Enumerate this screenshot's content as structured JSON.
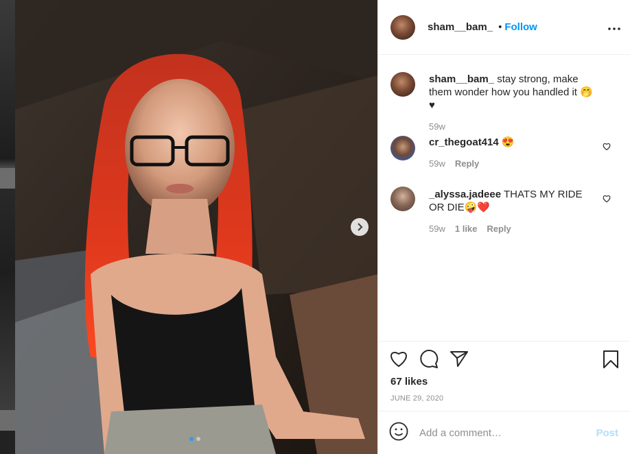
{
  "post": {
    "username": "sham__bam_",
    "separator": "•",
    "follow_label": "Follow"
  },
  "comments": [
    {
      "username": "sham__bam_",
      "text": " stay strong, make them wonder how you handled it 🤭♥",
      "time": "59w"
    },
    {
      "username": "cr_thegoat414",
      "text": " 😍",
      "time": "59w",
      "reply_label": "Reply"
    },
    {
      "username": "_alyssa.jadeee",
      "text": " THATS MY RIDE OR DIE🤪❤️",
      "time": "59w",
      "likes_label": "1 like",
      "reply_label": "Reply"
    }
  ],
  "likes_count": "67 likes",
  "post_date": "JUNE 29, 2020",
  "add_comment": {
    "placeholder": "Add a comment…",
    "post_label": "Post"
  },
  "carousel": {
    "total_slides": 2,
    "active_slide": 1
  },
  "icons": {
    "more": "more-options-icon",
    "next": "chevron-right-icon",
    "like": "heart-icon",
    "comment": "comment-bubble-icon",
    "share": "paper-plane-icon",
    "save": "bookmark-icon",
    "emoji": "smiley-icon"
  },
  "colors": {
    "follow": "#0095f6",
    "post_disabled": "#b2dffc",
    "muted": "#8e8e8e",
    "carousel_active_dot": "#3897f0"
  }
}
